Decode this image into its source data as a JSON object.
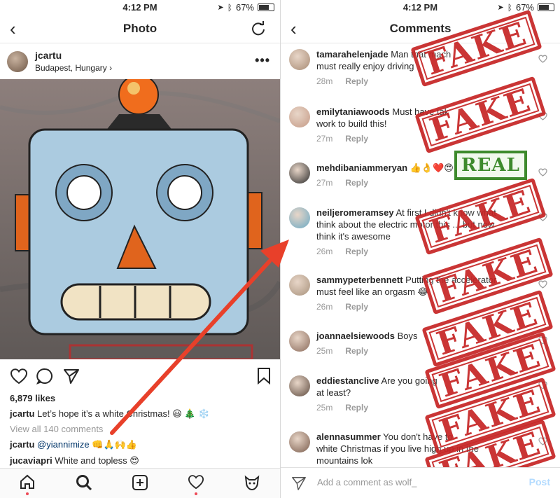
{
  "status": {
    "time": "4:12 PM",
    "battery": "67%"
  },
  "left": {
    "title": "Photo",
    "post": {
      "username": "jcartu",
      "location": "Budapest, Hungary ›",
      "likes": "6,879 likes",
      "caption_user": "jcartu",
      "caption_text": "Let’s hope it’s a white Christmas! 😃 🎄 ❄️",
      "view_all": "View all 140 comments",
      "comments": [
        {
          "user": "jcartu",
          "text": "@yiannimize 👊🙏🙌👍"
        },
        {
          "user": "jucaviapri",
          "text": "White and topless 😍"
        }
      ]
    },
    "tabs": [
      "home-icon",
      "search-icon",
      "add-icon",
      "heart-icon",
      "profile-icon"
    ]
  },
  "right": {
    "title": "Comments",
    "comments": [
      {
        "user": "tamarahelenjade",
        "line1": "Man that mach",
        "line2": "must really enjoy driving",
        "time": "28m",
        "reply": "Reply",
        "color": "#a88b74"
      },
      {
        "user": "emilytaniawoods",
        "line1": "Must have tak",
        "line2": "work to build this!",
        "time": "27m",
        "reply": "Reply",
        "color": "#c59a86"
      },
      {
        "user": "mehdibaniammeryan",
        "line1": "👍👌❤️😍",
        "line2": "",
        "time": "27m",
        "reply": "Reply",
        "color": "#2b2b2b"
      },
      {
        "user": "neiljeromeramsey",
        "line1": "At first I didn't know what",
        "line2": "think about the electric motor this ... but now",
        "line3": "think it's awesome",
        "time": "26m",
        "reply": "Reply",
        "color": "#6aa9c4"
      },
      {
        "user": "sammypeterbennett",
        "line1": "Putting the accelerator",
        "line2": "must feel like an orgasm 😂",
        "time": "26m",
        "reply": "Reply",
        "color": "#a8927c"
      },
      {
        "user": "joannaelsiewoods",
        "line1": "Boys",
        "line2": "",
        "time": "25m",
        "reply": "Reply",
        "color": "#8a6a5a"
      },
      {
        "user": "eddiestanclive",
        "line1": "Are you going",
        "line2": "at least?",
        "time": "25m",
        "reply": "Reply",
        "color": "#5d4a3e"
      },
      {
        "user": "alennasummer",
        "line1": "You don't have to",
        "line2": "white Christmas if you live high up in the",
        "line3": "mountains lok",
        "time": "",
        "reply": "",
        "color": "#7a5c4c"
      }
    ],
    "stamps": [
      "FAKE",
      "FAKE",
      "FAKE",
      "FAKE",
      "FAKE",
      "FAKE",
      "FAKE",
      "FAKE"
    ],
    "real_stamp": "REAL",
    "add_placeholder": "Add a comment as wolf_",
    "post_button": "Post"
  }
}
